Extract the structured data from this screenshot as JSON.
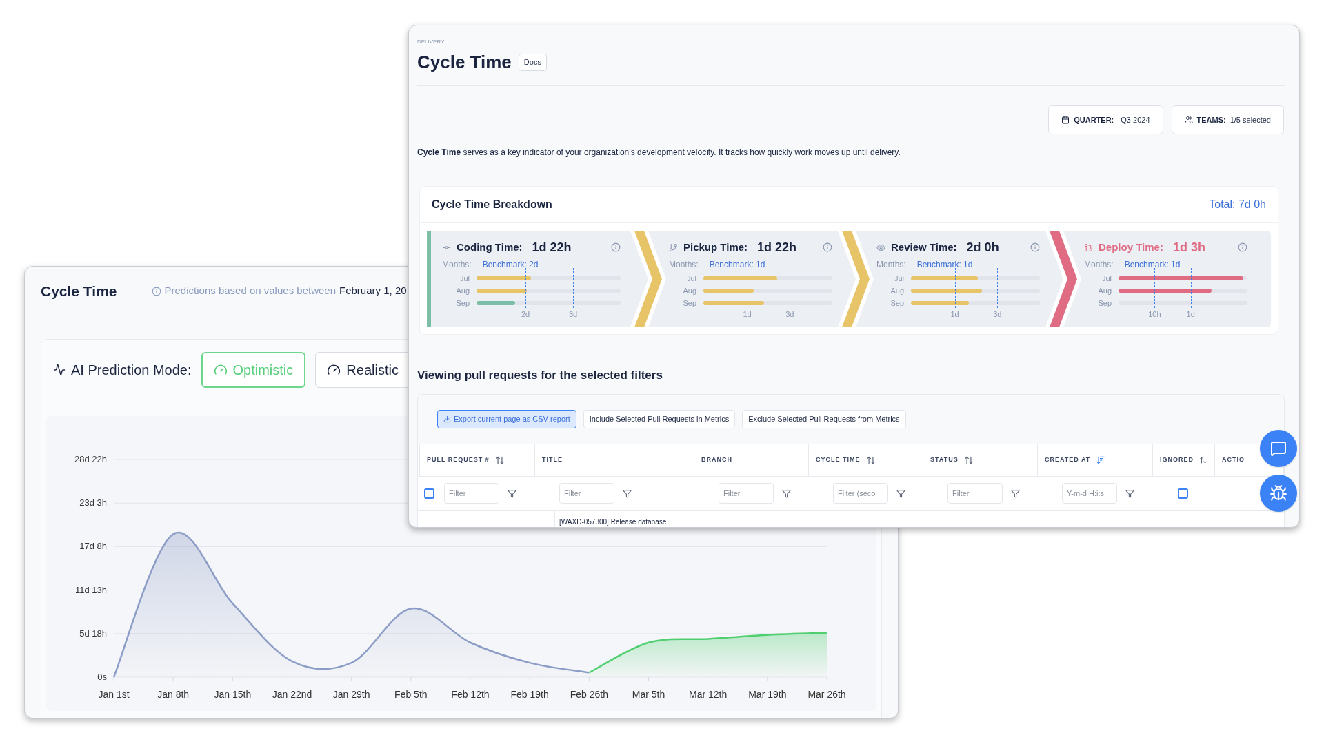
{
  "back_window": {
    "title": "Cycle Time",
    "note": "Predictions based on values between",
    "note_date": "February 1, 20",
    "mode_label": "AI Prediction Mode:",
    "modes": [
      {
        "label": "Optimistic",
        "selected": true
      },
      {
        "label": "Realistic",
        "selected": false
      }
    ],
    "y_axis_labels": [
      "28d 22h",
      "23d 3h",
      "17d 8h",
      "11d 13h",
      "5d 18h",
      "0s"
    ],
    "x_axis_labels": [
      "Jan 1st",
      "Jan 8th",
      "Jan 15th",
      "Jan 22nd",
      "Jan 29th",
      "Feb 5th",
      "Feb 12th",
      "Feb 19th",
      "Feb 26th",
      "Mar 5th",
      "Mar 12th",
      "Mar 19th",
      "Mar 26th"
    ]
  },
  "front_window": {
    "breadcrumb": "DELIVERY",
    "title": "Cycle Time",
    "docs_badge": "Docs",
    "filters": [
      {
        "kind": "calendar",
        "label": "QUARTER:",
        "value": "Q3 2024"
      },
      {
        "kind": "teams",
        "label": "TEAMS:",
        "value": "1/5 selected"
      }
    ],
    "description": "**Cycle Time** serves as a key indicator of your organization’s development velocity. It tracks how quickly work moves up until delivery.",
    "breakdown": {
      "title": "Cycle Time Breakdown",
      "total": "Total: 7d 0h",
      "stages": [
        {
          "kind": "coding",
          "label": "Coding Time:",
          "value": "1d 22h",
          "color": "#7dbfa6",
          "alert": false,
          "months_label": "Months:",
          "benchmark": "Benchmark: 2d",
          "bars": [
            {
              "month": "Jul",
              "level": 0.38,
              "color": "#e8c468"
            },
            {
              "month": "Aug",
              "level": 0.35,
              "color": "#e8c468"
            },
            {
              "month": "Sep",
              "level": 0.27,
              "color": "#7dbfa6"
            }
          ],
          "markers": [
            {
              "label": "2d",
              "level": 0.34
            },
            {
              "label": "3d",
              "level": 0.67
            }
          ]
        },
        {
          "kind": "pickup",
          "label": "Pickup Time:",
          "value": "1d 22h",
          "color": "#e8c468",
          "alert": false,
          "months_label": "Months:",
          "benchmark": "Benchmark: 1d",
          "bars": [
            {
              "month": "Jul",
              "level": 0.57,
              "color": "#e8c468"
            },
            {
              "month": "Aug",
              "level": 0.39,
              "color": "#e8c468"
            },
            {
              "month": "Sep",
              "level": 0.47,
              "color": "#e8c468"
            }
          ],
          "markers": [
            {
              "label": "1d",
              "level": 0.34
            },
            {
              "label": "3d",
              "level": 0.67
            }
          ]
        },
        {
          "kind": "review",
          "label": "Review Time:",
          "value": "2d 0h",
          "color": "#e8c468",
          "alert": false,
          "months_label": "Months:",
          "benchmark": "Benchmark: 1d",
          "bars": [
            {
              "month": "Jul",
              "level": 0.52,
              "color": "#e8c468"
            },
            {
              "month": "Aug",
              "level": 0.55,
              "color": "#e8c468"
            },
            {
              "month": "Sep",
              "level": 0.45,
              "color": "#e8c468"
            }
          ],
          "markers": [
            {
              "label": "1d",
              "level": 0.34
            },
            {
              "label": "3d",
              "level": 0.67
            }
          ]
        },
        {
          "kind": "deploy",
          "label": "Deploy Time:",
          "value": "1d 3h",
          "color": "#e06c84",
          "alert": true,
          "months_label": "Months:",
          "benchmark": "Benchmark: 1d",
          "bars": [
            {
              "month": "Jul",
              "level": 0.97,
              "color": "#e06c84"
            },
            {
              "month": "Aug",
              "level": 0.72,
              "color": "#e06c84"
            },
            {
              "month": "Sep"
            }
          ],
          "markers": [
            {
              "label": "10h",
              "level": 0.28
            },
            {
              "label": "1d",
              "level": 0.56
            }
          ]
        }
      ]
    },
    "pull_requests": {
      "heading": "Viewing pull requests for the selected filters",
      "actions": [
        {
          "label": "Export current page as CSV report",
          "primary": true
        },
        {
          "label": "Include Selected Pull Requests in Metrics",
          "primary": false
        },
        {
          "label": "Exclude Selected Pull Requests from Metrics",
          "primary": false
        }
      ],
      "select_all": {
        "checked": false
      },
      "columns": [
        {
          "label": "PULL REQUEST #",
          "sorted": false
        },
        {
          "label": "TITLE"
        },
        {
          "label": "BRANCH"
        },
        {
          "label": "CYCLE TIME",
          "sorted": false
        },
        {
          "label": "STATUS",
          "sorted": false
        },
        {
          "label": "CREATED AT",
          "sorted": true
        },
        {
          "label": "IGNORED",
          "sorted": false
        },
        {
          "label": "ACTIO"
        }
      ],
      "filters": [
        {
          "kind": "text",
          "placeholder": "Filter"
        },
        {
          "kind": "text",
          "placeholder": "Filter"
        },
        {
          "kind": "text",
          "placeholder": "Filter"
        },
        {
          "kind": "text",
          "placeholder": "Filter (seco"
        },
        {
          "kind": "text",
          "placeholder": "Filter"
        },
        {
          "kind": "text",
          "placeholder": "Y-m-d H:i:s"
        },
        {
          "kind": "checkbox",
          "checked": false
        }
      ],
      "rows": [
        {
          "title": "[WAXD-057300] Release database"
        }
      ]
    }
  },
  "floating_buttons": [
    {
      "kind": "chat"
    },
    {
      "kind": "bug"
    }
  ]
}
